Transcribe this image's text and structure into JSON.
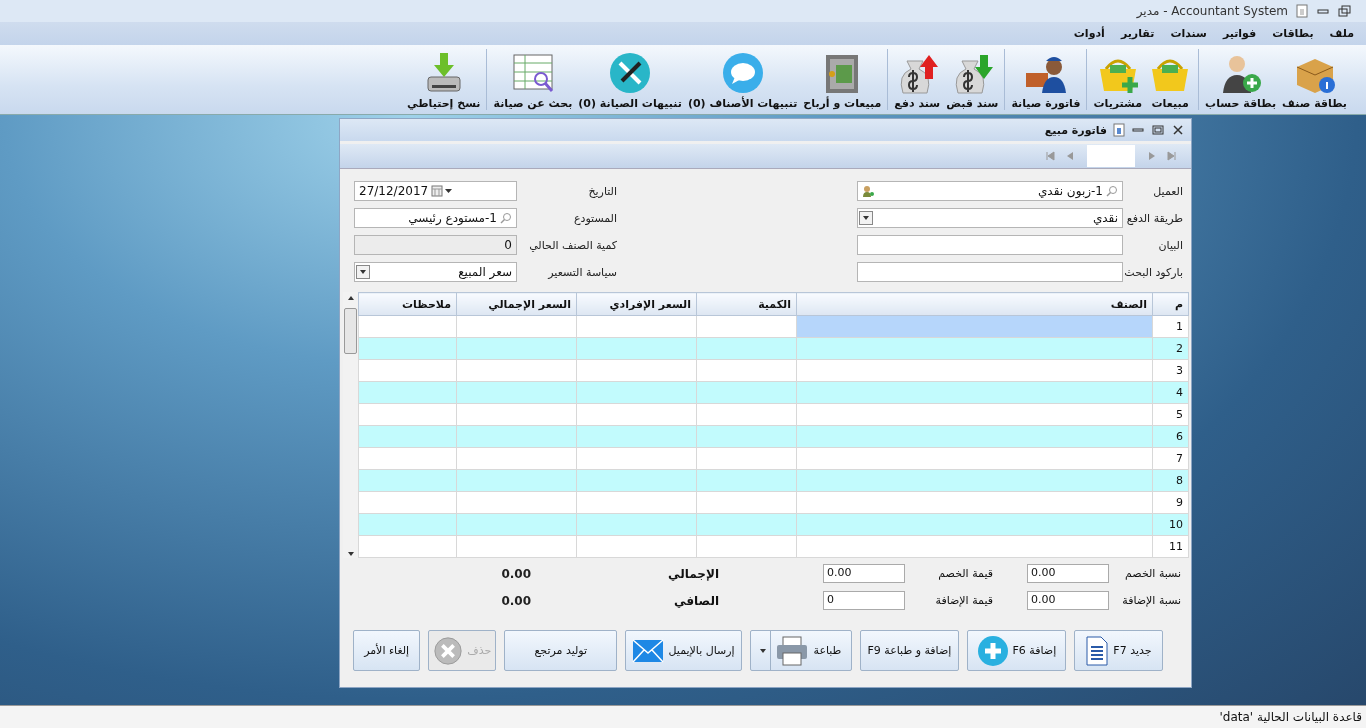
{
  "window": {
    "title": "مدير - Accountant System"
  },
  "menu": [
    "ملف",
    "بطاقات",
    "فواتير",
    "سندات",
    "تقارير",
    "أدوات"
  ],
  "toolbar": {
    "groups": [
      [
        {
          "label": "بطاقة صنف",
          "kind": "box"
        },
        {
          "label": "بطاقة حساب",
          "kind": "user"
        }
      ],
      [
        {
          "label": "مبيعات",
          "kind": "basket"
        },
        {
          "label": "مشتريات",
          "kind": "basket-plus"
        }
      ],
      [
        {
          "label": "فاتورة صيانة",
          "kind": "worker"
        }
      ],
      [
        {
          "label": "سند قبض",
          "kind": "money-in"
        },
        {
          "label": "سند دفع",
          "kind": "money-out"
        }
      ],
      [
        {
          "label": "مبيعات و أرباح",
          "kind": "safe"
        },
        {
          "label": "تنبيهات الأصناف (0)",
          "kind": "chat"
        },
        {
          "label": "تنبيهات الصيانة (0)",
          "kind": "tools"
        },
        {
          "label": "بحث عن صيانة",
          "kind": "sheet"
        }
      ],
      [
        {
          "label": "نسخ إحتياطي",
          "kind": "backup"
        }
      ]
    ]
  },
  "invoice": {
    "title": "فاتورة مبيع",
    "fields_right": [
      {
        "label": "العميل",
        "value": "1-زبون نقدي",
        "kind": "lookup-person"
      },
      {
        "label": "طريقة الدفع",
        "value": "نقدي",
        "kind": "dropdown"
      },
      {
        "label": "البيان",
        "kind": "text"
      },
      {
        "label": "باركود البحث",
        "kind": "text"
      }
    ],
    "fields_left": [
      {
        "label": "التاريخ",
        "value": "27/12/2017",
        "kind": "date"
      },
      {
        "label": "المستودع",
        "value": "1-مستودع رئيسي",
        "kind": "lookup"
      },
      {
        "label": "كمية الصنف الحالي",
        "value": "0",
        "kind": "readonly"
      },
      {
        "label": "سياسة التسعير",
        "value": "سعر المبيع",
        "kind": "dropdown"
      }
    ],
    "table": {
      "columns": [
        "م",
        "الصنف",
        "الكمية",
        "السعر الإفرادي",
        "السعر الإجمالي",
        "ملاحظات"
      ],
      "rows": [
        {
          "number": "1",
          "selected": true
        },
        {
          "number": "2",
          "selected": false
        },
        {
          "number": "3",
          "selected": false
        },
        {
          "number": "4",
          "selected": false
        },
        {
          "number": "5",
          "selected": false
        },
        {
          "number": "6",
          "selected": false
        },
        {
          "number": "7",
          "selected": false
        },
        {
          "number": "8",
          "selected": false
        },
        {
          "number": "9",
          "selected": false
        },
        {
          "number": "10",
          "selected": false
        },
        {
          "number": "11",
          "selected": false
        }
      ]
    },
    "totals": [
      {
        "percent_label": "نسبة الخصم",
        "percent": "0.00",
        "amount_label": "قيمة الخصم",
        "amount": "0.00",
        "sum_label": "الإجمالي",
        "sum": "0.00"
      },
      {
        "percent_label": "نسبة الإضافة",
        "percent": "0.00",
        "amount_label": "قيمة الإضافة",
        "amount": "0",
        "sum_label": "الصافي",
        "sum": "0.00"
      }
    ],
    "buttons": [
      {
        "label": "جديد F7",
        "kind": "new",
        "disabled": false
      },
      {
        "label": "إضافة F6",
        "kind": "add",
        "disabled": false
      },
      {
        "label": "إضافة و طباعة F9",
        "kind": "plain",
        "disabled": false
      },
      {
        "label": "طباعة",
        "kind": "print",
        "disabled": false
      },
      {
        "label": "إرسال بالإيميل",
        "kind": "email",
        "disabled": false
      },
      {
        "label": "توليد مرتجع",
        "kind": "plain",
        "disabled": false
      },
      {
        "label": "حذف",
        "kind": "delete",
        "disabled": true
      },
      {
        "label": "إلغاء الأمر",
        "kind": "plain",
        "disabled": false
      }
    ]
  },
  "status_bar": "قاعدة البيانات الحالية 'data'"
}
